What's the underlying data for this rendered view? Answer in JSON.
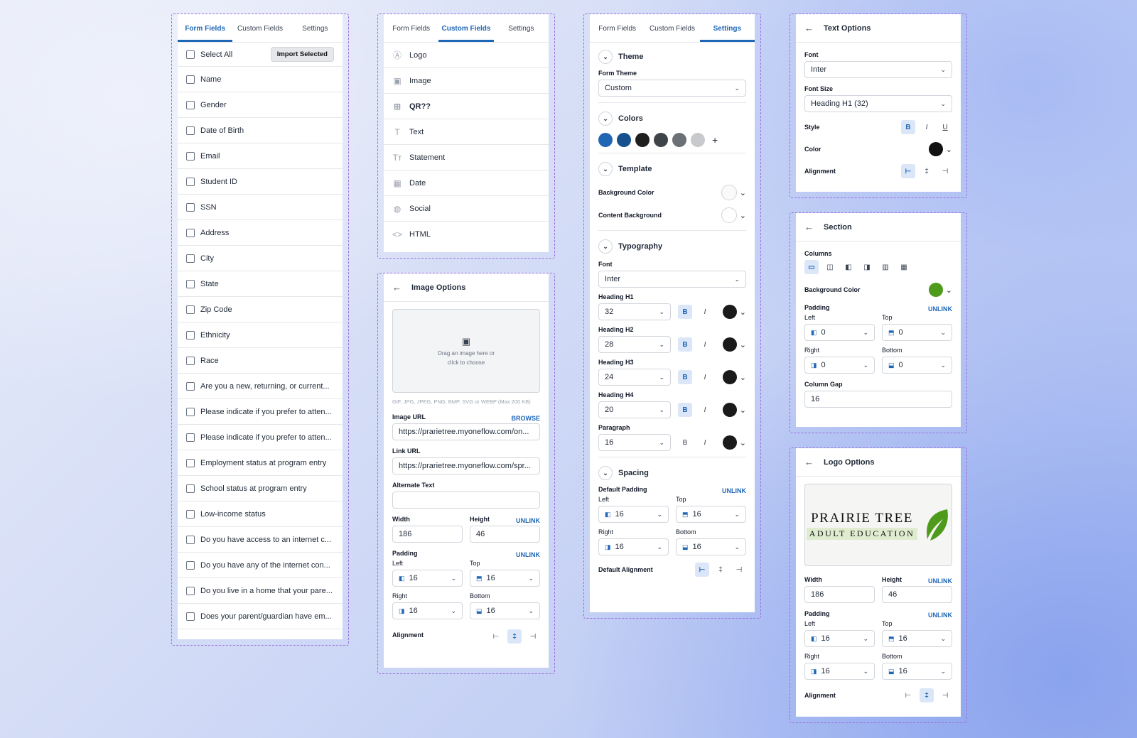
{
  "form_fields": {
    "tabs": [
      "Form Fields",
      "Custom Fields",
      "Settings"
    ],
    "select_all": "Select All",
    "import_button": "Import Selected",
    "items": [
      "Name",
      "Gender",
      "Date of Birth",
      "Email",
      "Student ID",
      "SSN",
      "Address",
      "City",
      "State",
      "Zip Code",
      "Ethnicity",
      "Race",
      "Are you a new, returning, or current...",
      "Please indicate if you prefer to atten...",
      "Please indicate if you prefer to atten...",
      "Employment status at program entry",
      "School status at program entry",
      "Low-income status",
      "Do you have access to an internet c...",
      "Do you have any of the internet con...",
      "Do you live in a home that your pare...",
      "Does your parent/guardian have em..."
    ]
  },
  "custom_fields": {
    "tabs": [
      "Form Fields",
      "Custom Fields",
      "Settings"
    ],
    "items": [
      {
        "label": "Logo",
        "icon": "logo-icon"
      },
      {
        "label": "Image",
        "icon": "image-icon"
      },
      {
        "label": "QR??",
        "icon": "qr-icon"
      },
      {
        "label": "Text",
        "icon": "text-icon"
      },
      {
        "label": "Statement",
        "icon": "statement-icon"
      },
      {
        "label": "Date",
        "icon": "calendar-icon"
      },
      {
        "label": "Social",
        "icon": "globe-icon"
      },
      {
        "label": "HTML",
        "icon": "code-icon"
      }
    ]
  },
  "image_options": {
    "title": "Image Options",
    "drop_text_1": "Drag an image here or",
    "drop_text_2": "click to choose",
    "formats": "GIF, JPG, JPEG, PNG, BMP, SVG or WEBP (Max 200 KB)",
    "image_url_label": "Image URL",
    "browse": "BROWSE",
    "image_url": "https://prarietree.myoneflow.com/on...",
    "link_url_label": "Link URL",
    "link_url": "https://prarietree.myoneflow.com/spr...",
    "alt_label": "Alternate Text",
    "width_label": "Width",
    "height_label": "Height",
    "unlink": "UNLINK",
    "width": "186",
    "height": "46",
    "padding_label": "Padding",
    "left_label": "Left",
    "top_label": "Top",
    "right_label": "Right",
    "bottom_label": "Bottom",
    "pad_left": "16",
    "pad_top": "16",
    "pad_right": "16",
    "pad_bottom": "16",
    "alignment_label": "Alignment"
  },
  "settings": {
    "tabs": [
      "Form Fields",
      "Custom Fields",
      "Settings"
    ],
    "theme": "Theme",
    "form_theme_label": "Form Theme",
    "form_theme": "Custom",
    "colors": "Colors",
    "swatches": [
      "#1f66b5",
      "#17508f",
      "#1f1f1f",
      "#3f444b",
      "#6b7076",
      "#c8c9cc"
    ],
    "template": "Template",
    "bg_color_label": "Background Color",
    "content_bg_label": "Content Background",
    "typography": "Typography",
    "font_label": "Font",
    "font": "Inter",
    "headings": [
      {
        "label": "Heading H1",
        "size": "32",
        "bold": true
      },
      {
        "label": "Heading H2",
        "size": "28",
        "bold": true
      },
      {
        "label": "Heading H3",
        "size": "24",
        "bold": true
      },
      {
        "label": "Heading H4",
        "size": "20",
        "bold": true
      },
      {
        "label": "Paragraph",
        "size": "16",
        "bold": false
      }
    ],
    "spacing": "Spacing",
    "default_padding_label": "Default Padding",
    "unlink": "UNLINK",
    "left_label": "Left",
    "top_label": "Top",
    "right_label": "Right",
    "bottom_label": "Bottom",
    "pad_left": "16",
    "pad_top": "16",
    "pad_right": "16",
    "pad_bottom": "16",
    "default_alignment_label": "Default Alignment"
  },
  "text_options": {
    "title": "Text Options",
    "font_label": "Font",
    "font": "Inter",
    "font_size_label": "Font Size",
    "font_size": "Heading H1 (32)",
    "style_label": "Style",
    "color_label": "Color",
    "alignment_label": "Alignment"
  },
  "section": {
    "title": "Section",
    "columns_label": "Columns",
    "bg_color_label": "Background Color",
    "bg_color": "#4e9a1a",
    "padding_label": "Padding",
    "unlink": "UNLINK",
    "left_label": "Left",
    "top_label": "Top",
    "right_label": "Right",
    "bottom_label": "Bottom",
    "pad_left": "0",
    "pad_top": "0",
    "pad_right": "0",
    "pad_bottom": "0",
    "column_gap_label": "Column Gap",
    "column_gap": "16"
  },
  "logo_options": {
    "title": "Logo Options",
    "logo_line1": "PRAIRIE TREE",
    "logo_line2": "ADULT EDUCATION",
    "width_label": "Width",
    "height_label": "Height",
    "unlink": "UNLINK",
    "width": "186",
    "height": "46",
    "padding_label": "Padding",
    "left_label": "Left",
    "top_label": "Top",
    "right_label": "Right",
    "bottom_label": "Bottom",
    "pad_left": "16",
    "pad_top": "16",
    "pad_right": "16",
    "pad_bottom": "16",
    "alignment_label": "Alignment"
  },
  "colors": {
    "accent": "#1f66b5",
    "frame": "#9b6fe0",
    "logo_green": "#4e9a1a"
  }
}
